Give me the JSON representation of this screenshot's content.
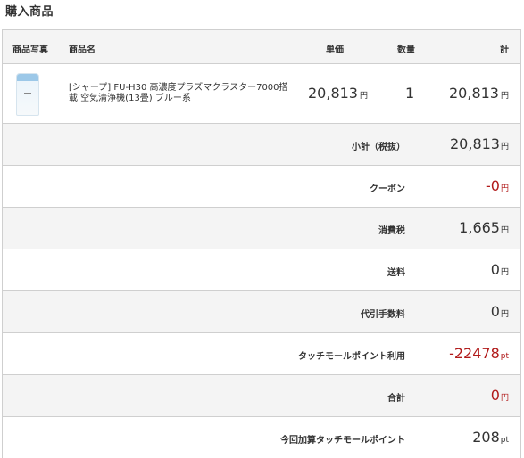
{
  "heading": "購入商品",
  "table": {
    "headers": {
      "photo": "商品写真",
      "name": "商品名",
      "unit_price": "単価",
      "quantity": "数量",
      "total": "計"
    },
    "item": {
      "name": "[シャープ] FU-H30 高濃度プラズマクラスター7000搭載 空気清浄機(13畳) ブルー系",
      "unit_price": "20,813",
      "unit_price_unit": "円",
      "quantity": "1",
      "total": "20,813",
      "total_unit": "円",
      "thumbnail_icon": "air-purifier-image"
    },
    "summary": [
      {
        "label": "小計（税抜）",
        "value": "20,813",
        "unit": "円",
        "color": "#333333"
      },
      {
        "label": "クーポン",
        "value": "-0",
        "unit": "円",
        "color": "#b11a1a"
      },
      {
        "label": "消費税",
        "value": "1,665",
        "unit": "円",
        "color": "#333333"
      },
      {
        "label": "送料",
        "value": "0",
        "unit": "円",
        "color": "#333333"
      },
      {
        "label": "代引手数料",
        "value": "0",
        "unit": "円",
        "color": "#333333"
      },
      {
        "label": "タッチモールポイント利用",
        "value": "-22478",
        "unit": "pt",
        "color": "#b11a1a"
      },
      {
        "label": "合計",
        "value": "0",
        "unit": "円",
        "color": "#b11a1a"
      },
      {
        "label": "今回加算タッチモールポイント",
        "value": "208",
        "unit": "pt",
        "color": "#333333"
      }
    ]
  }
}
